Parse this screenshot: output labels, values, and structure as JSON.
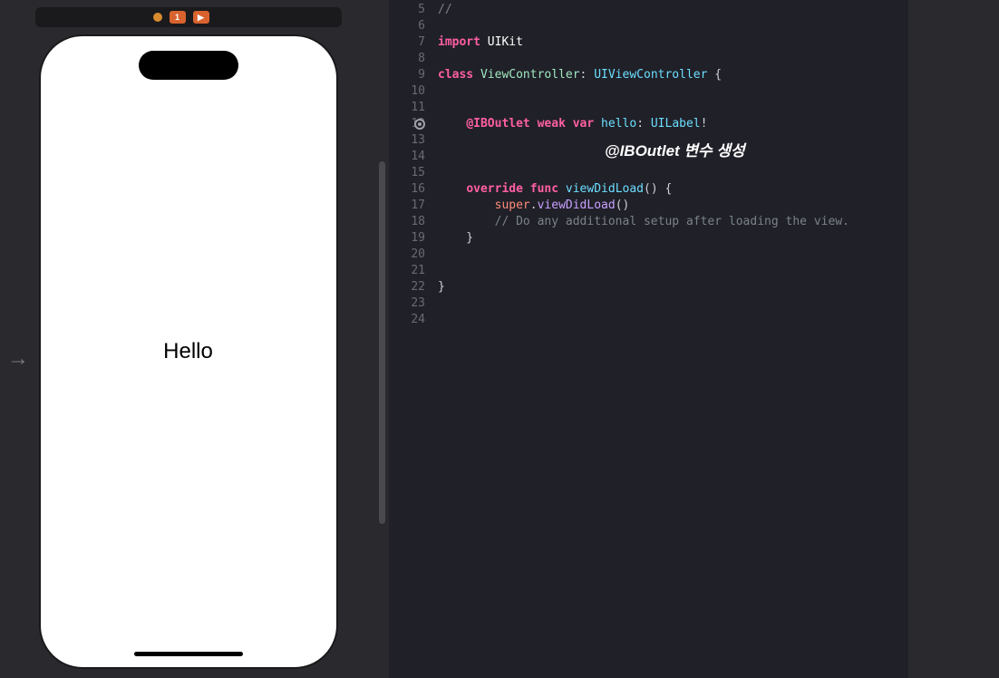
{
  "preview": {
    "label_text": "Hello"
  },
  "toolbar": {
    "badge1": "1"
  },
  "annotation": "@IBOutlet 변수 생성",
  "gutter": {
    "start": 5,
    "end": 24,
    "outlet_line": 12
  },
  "code_lines": [
    {
      "n": 5,
      "tokens": [
        {
          "t": "//",
          "c": "comment"
        }
      ]
    },
    {
      "n": 6,
      "tokens": []
    },
    {
      "n": 7,
      "tokens": [
        {
          "t": "import",
          "c": "keyword"
        },
        {
          "t": " ",
          "c": "plain"
        },
        {
          "t": "UIKit",
          "c": "plain"
        }
      ]
    },
    {
      "n": 8,
      "tokens": []
    },
    {
      "n": 9,
      "tokens": [
        {
          "t": "class",
          "c": "keyword"
        },
        {
          "t": " ",
          "c": "plain"
        },
        {
          "t": "ViewController",
          "c": "classname"
        },
        {
          "t": ": ",
          "c": "punct"
        },
        {
          "t": "UIViewController",
          "c": "type"
        },
        {
          "t": " {",
          "c": "punct"
        }
      ]
    },
    {
      "n": 10,
      "tokens": []
    },
    {
      "n": 11,
      "tokens": []
    },
    {
      "n": 12,
      "tokens": [
        {
          "t": "    ",
          "c": "plain"
        },
        {
          "t": "@IBOutlet",
          "c": "keyword"
        },
        {
          "t": " ",
          "c": "plain"
        },
        {
          "t": "weak",
          "c": "keyword"
        },
        {
          "t": " ",
          "c": "plain"
        },
        {
          "t": "var",
          "c": "keyword"
        },
        {
          "t": " ",
          "c": "plain"
        },
        {
          "t": "hello",
          "c": "ident"
        },
        {
          "t": ": ",
          "c": "punct"
        },
        {
          "t": "UILabel",
          "c": "type"
        },
        {
          "t": "!",
          "c": "punct"
        }
      ]
    },
    {
      "n": 13,
      "tokens": []
    },
    {
      "n": 14,
      "tokens": []
    },
    {
      "n": 15,
      "tokens": []
    },
    {
      "n": 16,
      "tokens": [
        {
          "t": "    ",
          "c": "plain"
        },
        {
          "t": "override",
          "c": "keyword"
        },
        {
          "t": " ",
          "c": "plain"
        },
        {
          "t": "func",
          "c": "keyword"
        },
        {
          "t": " ",
          "c": "plain"
        },
        {
          "t": "viewDidLoad",
          "c": "ident"
        },
        {
          "t": "() {",
          "c": "punct"
        }
      ]
    },
    {
      "n": 17,
      "tokens": [
        {
          "t": "        ",
          "c": "plain"
        },
        {
          "t": "super",
          "c": "super"
        },
        {
          "t": ".",
          "c": "punct"
        },
        {
          "t": "viewDidLoad",
          "c": "method"
        },
        {
          "t": "()",
          "c": "punct"
        }
      ]
    },
    {
      "n": 18,
      "tokens": [
        {
          "t": "        ",
          "c": "plain"
        },
        {
          "t": "// Do any additional setup after loading the view.",
          "c": "comment"
        }
      ]
    },
    {
      "n": 19,
      "tokens": [
        {
          "t": "    }",
          "c": "punct"
        }
      ]
    },
    {
      "n": 20,
      "tokens": []
    },
    {
      "n": 21,
      "tokens": []
    },
    {
      "n": 22,
      "tokens": [
        {
          "t": "}",
          "c": "punct"
        }
      ]
    },
    {
      "n": 23,
      "tokens": []
    },
    {
      "n": 24,
      "tokens": []
    }
  ]
}
